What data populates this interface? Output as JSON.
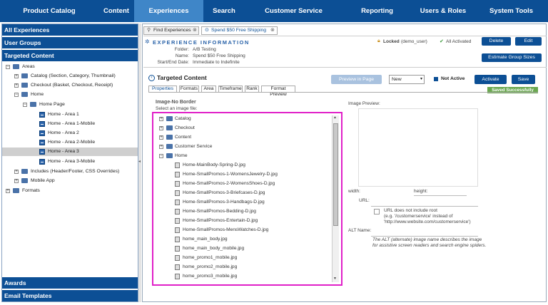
{
  "nav": [
    "Product Catalog",
    "Content",
    "Experiences",
    "Search",
    "Customer Service",
    "Reporting",
    "Users & Roles",
    "System Tools"
  ],
  "sidebar": {
    "all_experiences": "All Experiences",
    "user_groups": "User Groups",
    "targeted_content": "Targeted Content",
    "awards": "Awards",
    "email_templates": "Email Templates",
    "tree": {
      "areas": "Areas",
      "catalog": "Catalog (Section, Category, Thumbnail)",
      "checkout": "Checkout (Basket, Checkout, Receipt)",
      "home": "Home",
      "home_page": "Home Page",
      "area1": "Home - Area 1",
      "area1m": "Home - Area 1-Mobile",
      "area2": "Home - Area 2",
      "area2m": "Home - Area 2-Mobile",
      "area3": "Home - Area 3",
      "area3m": "Home - Area 3-Mobile",
      "includes": "Includes (Header/Footer, CSS Overrides)",
      "mobile_app": "Mobile App",
      "formats": "Formats"
    }
  },
  "tabs": [
    "Find Experiences",
    "Spend $50 Free Shipping"
  ],
  "experience": {
    "heading": "EXPERIENCE INFORMATION",
    "folder_label": "Folder:",
    "folder": "A/B Testing",
    "name_label": "Name:",
    "name": "Spend $50 Free Shipping",
    "dates_label": "Start/End Date:",
    "dates": "Immediate to Indefinite",
    "locked": "Locked",
    "locked_user": "(demo_user)",
    "all_activated": "All Activated",
    "delete": "Delete",
    "edit": "Edit",
    "estimate": "Estimate Group Sizes"
  },
  "tc": {
    "title": "Targeted Content",
    "preview": "Preview in Page",
    "status": "New",
    "not_active": "Not Active",
    "activate": "Activate",
    "save": "Save",
    "saved": "Saved Successfully",
    "subtabs": [
      "Properties",
      "Formats",
      "Area",
      "Timeframe",
      "Rank",
      "Format Preview"
    ],
    "image_title": "Image-No Border",
    "select_label": "Select an image file:",
    "folders": [
      "Catalog",
      "Checkout",
      "Content",
      "Customer Service",
      "Home"
    ],
    "files": [
      "Home-MainBody-Spring-D.jpg",
      "Home-SmallPromos-1-WomensJewelry-D.jpg",
      "Home-SmallPromos-2-WomensShoes-D.jpg",
      "Home-SmallPromos-3-Briefcases-D.jpg",
      "Home-SmallPromos-3-Handbags-D.jpg",
      "Home-SmallPromos-Bedding-D.jpg",
      "Home-SmallPromos-Entertain-D.jpg",
      "Home-SmallPromos-MensWatches-D.jpg",
      "home_main_body.jpg",
      "home_main_body_mobile.jpg",
      "home_promo1_mobile.jpg",
      "home_promo2_mobile.jpg",
      "home_promo3_mobile.jpg"
    ],
    "image_preview": "Image Preview:",
    "width": "width:",
    "height": "height:",
    "url": "URL:",
    "url_root": "URL does not include root",
    "url_eg1": "(e.g. '/customerservice' instead of",
    "url_eg2": "'http://www.website.com/customerservice')",
    "alt": "ALT Name:",
    "alt_desc1": "The ALT (alternate) image name describes the image",
    "alt_desc2": "for assistive screen readers and search engine spiders."
  },
  "colors": {
    "nav": "#0c4f95",
    "nav_active": "#3f86c8",
    "highlight": "#e020c8",
    "saved": "#6aa84f"
  }
}
